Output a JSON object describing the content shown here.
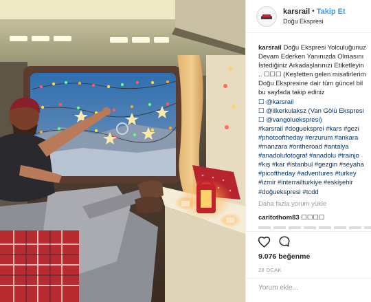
{
  "post": {
    "image_alt": "",
    "colors": {
      "follow": "#3897f0",
      "hashtag": "#003569",
      "muted": "#999999"
    }
  },
  "header": {
    "username": "karsrail",
    "separator": "•",
    "follow_label": "Takip Et",
    "location": "Doğu Ekspresi"
  },
  "caption": {
    "username": "karsrail",
    "lines": [
      "Doğu Ekspresi Yolculuğunuz",
      "Devam Ederken Yanınızda Olmasını",
      "İstediğiniz Arkadaşlarınızı Etiketleyin",
      ".. ☐☐☐ (Keşfetten gelen misafirlerim",
      "Doğu Ekspresine dair tüm güncel bil",
      "bu sayfada takip ediniz",
      "☐ @karsrail",
      "☐ @ilkerkulaksz (Van Gölü Ekspresi",
      "☐ @vangoluekspresi)",
      "#karsrail #dogueksprei #kars #gezi",
      "#photooftheday #erzurum #ankara",
      "#manzara #ontheroad #antalya",
      "#anadolufotograf #anadolu #trainjo",
      "#kış #kar #istanbul #gezgin #seyaha",
      "#picoftheday #adventures #turkey",
      "#izmir #interrailturkiye #eskişehir",
      "#doğuekspresi #tcdd"
    ],
    "line_types": [
      "text",
      "text",
      "text",
      "text",
      "text",
      "text",
      "mention",
      "mention",
      "mention",
      "tag",
      "tag",
      "tag",
      "tag",
      "tag",
      "tag",
      "tag",
      "tag"
    ]
  },
  "comments": {
    "load_more": "Daha fazla yorum yükle",
    "first": {
      "username": "caritothom83",
      "text": "☐☐☐☐"
    }
  },
  "actions": {
    "like_icon": "heart-icon",
    "comment_icon": "comment-bubble-icon",
    "likes": "9.076 beğenme",
    "date": "28 OCAK"
  },
  "comment_box": {
    "placeholder": "Yorum ekle..."
  }
}
